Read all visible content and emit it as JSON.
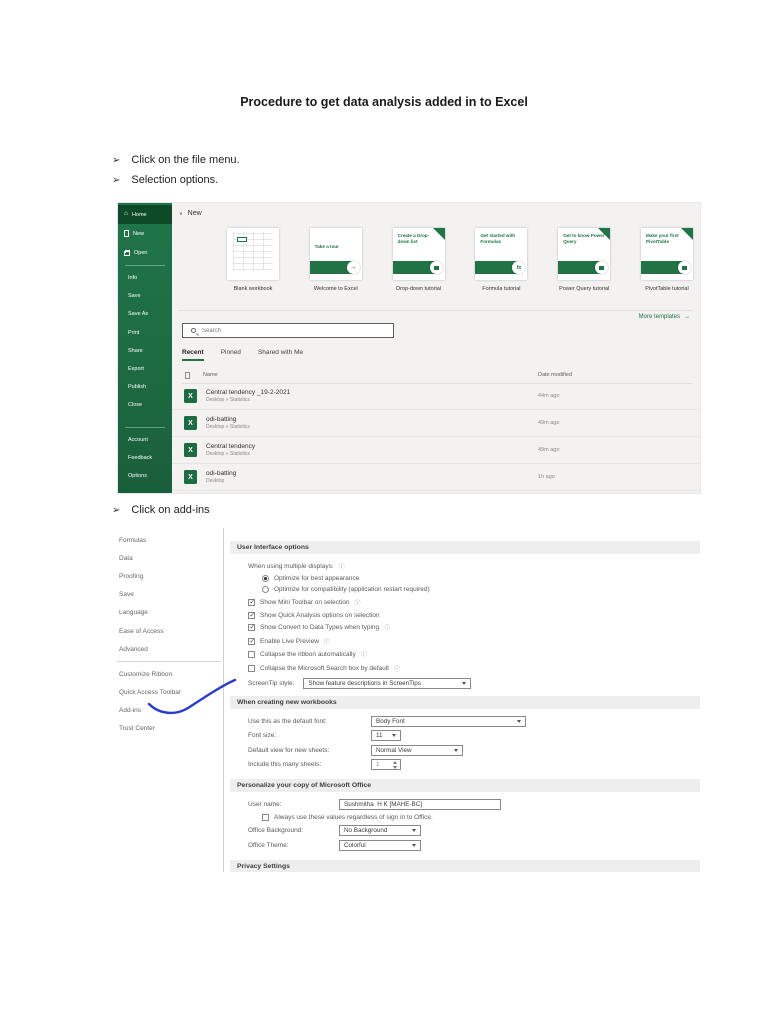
{
  "document": {
    "title": "Procedure to get data analysis added in to Excel",
    "bullet_glyph": "➢",
    "bullet1": "Click on the file menu.",
    "bullet2": "Selection options.",
    "bullet3": "Click on add-ins"
  },
  "backstage": {
    "sidebar": {
      "home": "Home",
      "new": "New",
      "open": "Open",
      "items": [
        "Info",
        "Save",
        "Save As",
        "Print",
        "Share",
        "Export",
        "Publish",
        "Close"
      ],
      "bottom": [
        "Account",
        "Feedback",
        "Options"
      ]
    },
    "new_section_label": "New",
    "templates": [
      {
        "card_text": "",
        "label": "Blank workbook"
      },
      {
        "card_text": "Take a tour",
        "label": "Welcome to Excel"
      },
      {
        "card_text": "Create a Drop-down list",
        "label": "Drop-down tutorial"
      },
      {
        "card_text": "Get started with Formulas",
        "label": "Formula tutorial"
      },
      {
        "card_text": "Get to know Power Query",
        "label": "Power Query tutorial"
      },
      {
        "card_text": "Make your first PivotTable",
        "label": "PivotTable tutorial"
      }
    ],
    "more_templates_label": "More templates",
    "search_placeholder": "Search",
    "tabs": [
      "Recent",
      "Pinned",
      "Shared with Me"
    ],
    "list_header": {
      "name": "Name",
      "date_modified": "Date modified"
    },
    "files": [
      {
        "name": "Central tendency _19-2-2021",
        "location": "Desktop » Statistics",
        "modified": "44m ago"
      },
      {
        "name": "odi-batting",
        "location": "Desktop » Statistics",
        "modified": "49m ago"
      },
      {
        "name": "Central tendency",
        "location": "Desktop » Statistics",
        "modified": "49m ago"
      },
      {
        "name": "odi-batting",
        "location": "Desktop",
        "modified": "1h ago"
      }
    ]
  },
  "options": {
    "menu": [
      "Formulas",
      "Data",
      "Proofing",
      "Save",
      "Language",
      "Ease of Access",
      "Advanced",
      "Customize Ribbon",
      "Quick Access Toolbar",
      "Add-ins",
      "Trust Center"
    ],
    "ui_section": {
      "title": "User Interface options",
      "displays_label": "When using multiple displays:",
      "radio1": "Optimize for best appearance",
      "radio2": "Optimize for compatibility (application restart required)",
      "checks": [
        {
          "label": "Show Mini Toolbar on selection",
          "checked": true
        },
        {
          "label": "Show Quick Analysis options on selection",
          "checked": true
        },
        {
          "label": "Show Convert to Data Types when typing",
          "checked": true
        },
        {
          "label": "Enable Live Preview",
          "checked": true
        },
        {
          "label": "Collapse the ribbon automatically",
          "checked": false
        },
        {
          "label": "Collapse the Microsoft Search box by default",
          "checked": false
        }
      ],
      "screentip_label": "ScreenTip style:",
      "screentip_value": "Show feature descriptions in ScreenTips"
    },
    "workbooks_section": {
      "title": "When creating new workbooks",
      "font_label": "Use this as the default font:",
      "font_value": "Body Font",
      "size_label": "Font size:",
      "size_value": "11",
      "view_label": "Default view for new sheets:",
      "view_value": "Normal View",
      "sheets_label": "Include this many sheets:",
      "sheets_value": "1"
    },
    "personalize_section": {
      "title": "Personalize your copy of Microsoft Office",
      "username_label": "User name:",
      "username_value": "Sushmitha  H K [MAHE-BC]",
      "always_label": "Always use these values regardless of sign in to Office.",
      "background_label": "Office Background:",
      "background_value": "No Background",
      "theme_label": "Office Theme:",
      "theme_value": "Colorful"
    },
    "privacy_section": {
      "title": "Privacy Settings"
    }
  },
  "colors": {
    "excel_green": "#217346",
    "annotation_blue": "#2a3cc7"
  }
}
